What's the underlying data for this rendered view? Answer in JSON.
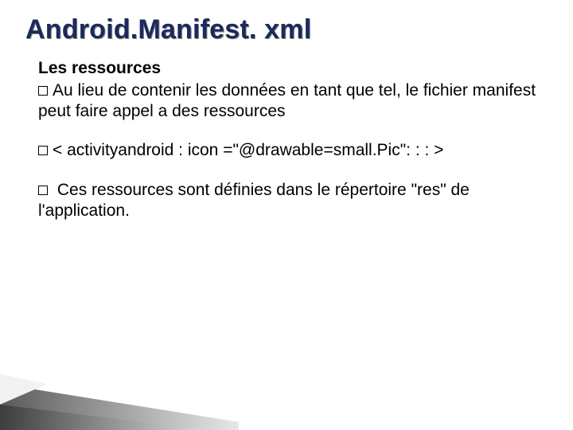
{
  "title": "Android.Manifest. xml",
  "heading": "Les ressources",
  "p1": "Au lieu de contenir les données en tant que tel, le fichier manifest peut faire appel a des ressources",
  "p2a": "<",
  "p2b": " activityandroid : icon =\"@drawable=small.Pic\": : : >",
  "p3": "Ces ressources sont définies dans le répertoire \"res\" de l'application."
}
